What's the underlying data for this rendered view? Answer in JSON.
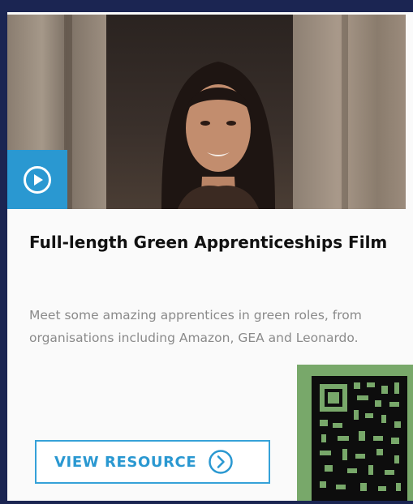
{
  "card": {
    "title": "Full-length Green Apprenticeships Film",
    "description": "Meet some amazing apprentices in green roles, from organisations including Amazon, GEA and Leonardo.",
    "cta_label": "VIEW RESOURCE"
  },
  "icons": {
    "play": "play-circle-icon",
    "cta": "chevron-right-circle-icon"
  },
  "colors": {
    "page_background": "#1b2552",
    "card_background": "#fafafa",
    "accent_blue": "#2a98d1",
    "title_text": "#111111",
    "body_text": "#8a8a8a",
    "qr_background": "#78a86a"
  }
}
